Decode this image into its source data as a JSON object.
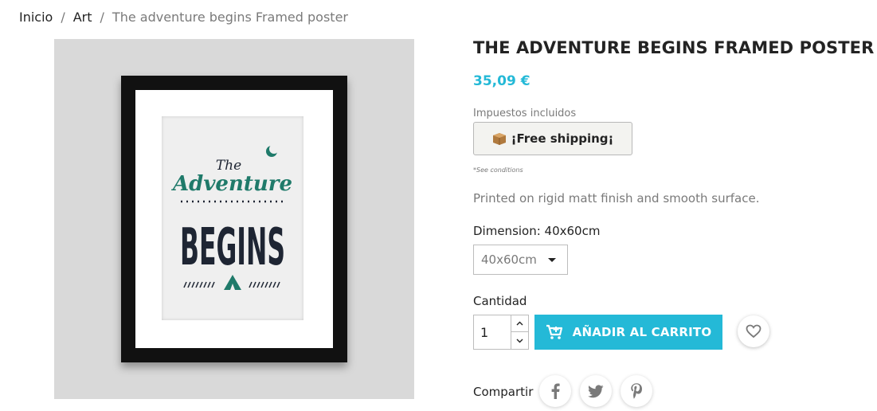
{
  "breadcrumb": {
    "items": [
      {
        "label": "Inicio"
      },
      {
        "label": "Art"
      },
      {
        "label": "The adventure begins Framed poster"
      }
    ],
    "separator": "/"
  },
  "product": {
    "title": "THE ADVENTURE BEGINS FRAMED POSTER",
    "price": "35,09 €",
    "tax_label": "Impuestos incluidos",
    "shipping_button": "¡Free shipping¡",
    "shipping_icon": "package-icon",
    "conditions_note": "*See conditions",
    "description": "Printed on rigid matt finish and smooth surface.",
    "poster_text": {
      "line1": "The",
      "line2": "Adventure",
      "line3": "BEGINS"
    }
  },
  "variant": {
    "label": "Dimension: 40x60cm",
    "selected": "40x60cm"
  },
  "quantity": {
    "label": "Cantidad",
    "value": "1"
  },
  "actions": {
    "add_to_cart": "AÑADIR AL CARRITO",
    "cart_icon": "cart-icon",
    "wishlist_icon": "heart-icon"
  },
  "share": {
    "label": "Compartir",
    "networks": [
      "facebook-icon",
      "twitter-icon",
      "pinterest-icon"
    ]
  },
  "colors": {
    "accent": "#24b9d7",
    "poster_green": "#1f7a6a",
    "poster_navy": "#1e2533"
  }
}
